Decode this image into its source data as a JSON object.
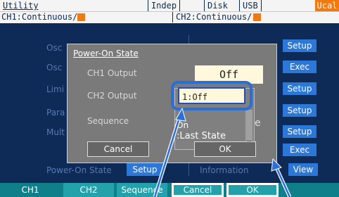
{
  "header": {
    "title": "Utility",
    "mode": "Indep",
    "disk": "Disk",
    "usb": "USB",
    "ucal": "Ucal",
    "ch1_status": "CH1:Continuous/",
    "ch2_status": "CH2:Continuous/"
  },
  "background_menu": {
    "left_labels": [
      "Osc",
      "Osc",
      "Limi",
      "Para",
      "Mult"
    ],
    "power_on_state_label": "Power-On State",
    "power_on_setup": "Setup",
    "information_label": "Information",
    "information_view": "View",
    "right_buttons": [
      "Setup",
      "Exec",
      "Setup",
      "Setup",
      "Setup",
      "Exec"
    ]
  },
  "dialog": {
    "title": "Power-On State",
    "ch1_output_label": "CH1 Output",
    "ch1_output_value": "Off",
    "ch2_output_label": "CH2 Output",
    "sequence_label": "Sequence",
    "dropdown_options": [
      "1:Off",
      "On",
      ":Last State"
    ],
    "dropdown_tail": "e",
    "cancel": "Cancel",
    "ok": "OK"
  },
  "footer": {
    "buttons": [
      "CH1",
      "CH2",
      "Sequence",
      "Cancel",
      "OK"
    ]
  },
  "colors": {
    "background": "#0e2a57",
    "accent_orange": "#f07a10",
    "button_blue": "#2b78d8",
    "footer_teal": "#0f7f8a"
  }
}
